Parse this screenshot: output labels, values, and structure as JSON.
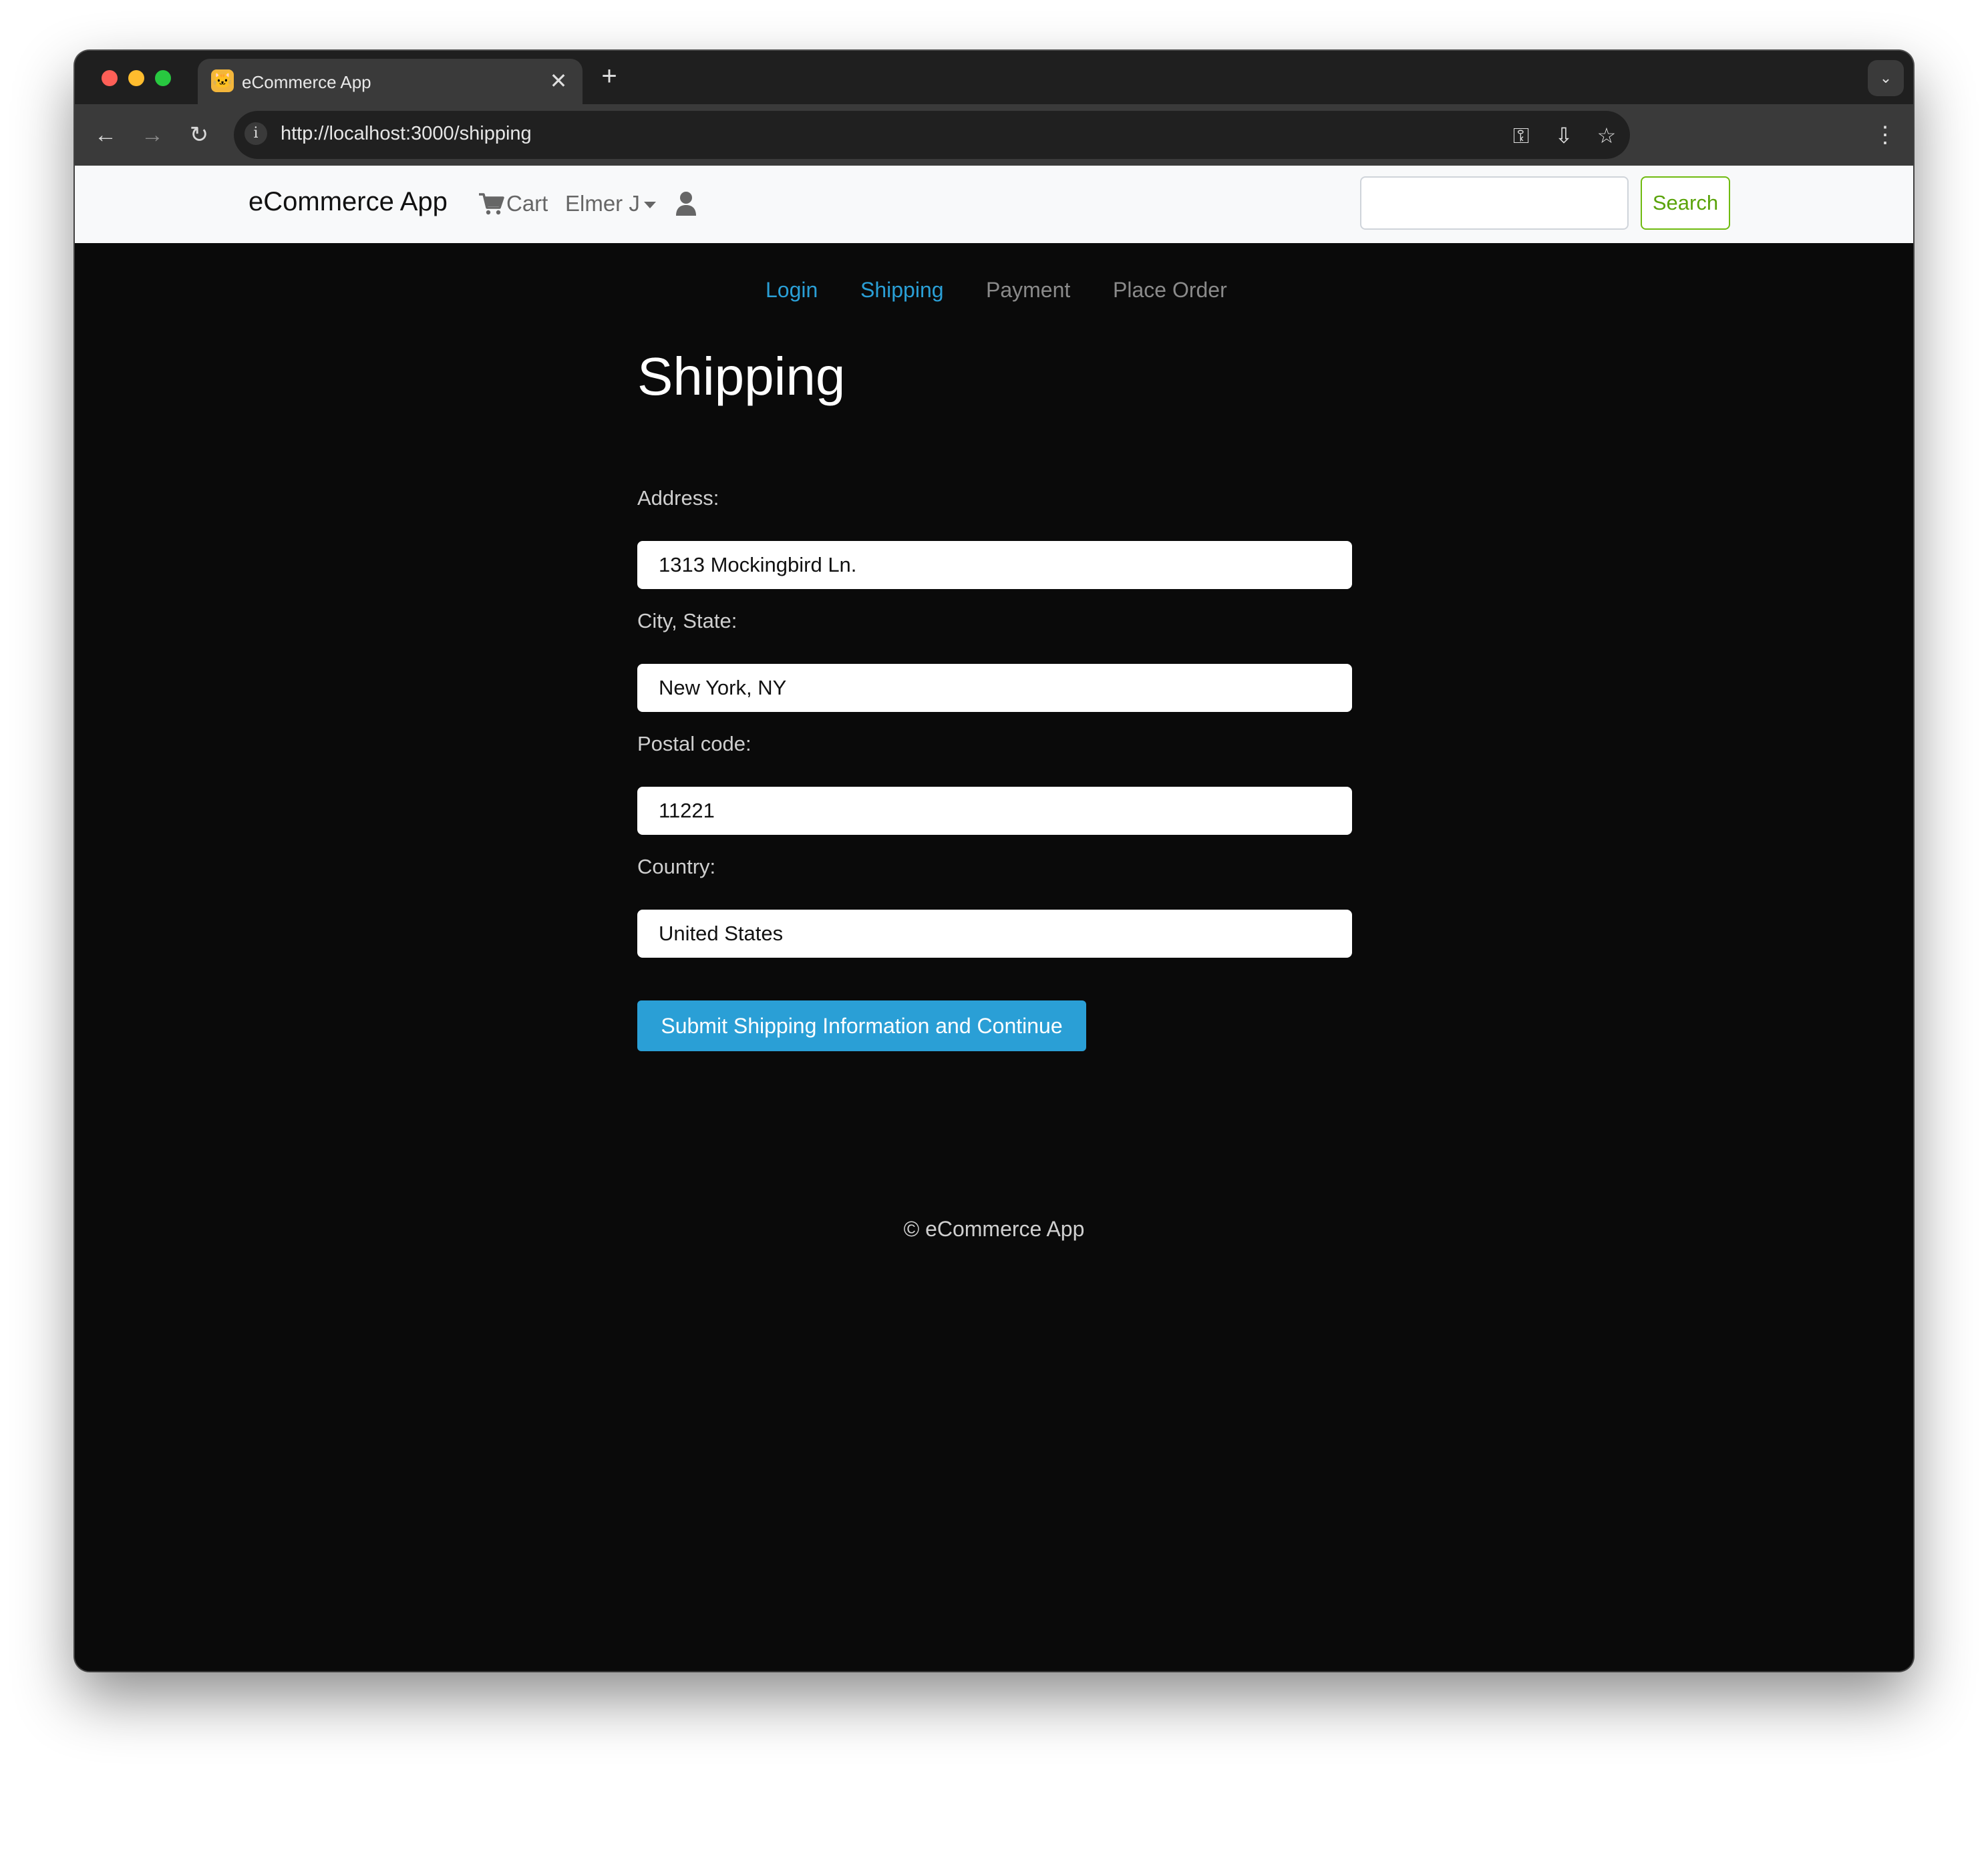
{
  "browser": {
    "tab_title": "eCommerce App",
    "tab_favicon": "🐱",
    "tab_close": "✕",
    "new_tab": "+",
    "tab_menu": "⌄",
    "back_icon": "←",
    "forward_icon": "→",
    "reload_icon": "↻",
    "url": "http://localhost:3000/shipping",
    "info_icon": "i",
    "key_icon": "⚿",
    "install_icon": "⇩",
    "star_icon": "☆",
    "menu_icon": "⋮"
  },
  "navbar": {
    "brand": "eCommerce App",
    "cart_label": "Cart",
    "user_name": "Elmer J",
    "search_placeholder": "",
    "search_button": "Search"
  },
  "steps": [
    {
      "label": "Login",
      "state": "active"
    },
    {
      "label": "Shipping",
      "state": "active"
    },
    {
      "label": "Payment",
      "state": "disabled"
    },
    {
      "label": "Place Order",
      "state": "disabled"
    }
  ],
  "form": {
    "title": "Shipping",
    "fields": [
      {
        "label": "Address:",
        "value": "1313 Mockingbird Ln."
      },
      {
        "label": "City, State:",
        "value": "New York, NY"
      },
      {
        "label": "Postal code:",
        "value": "11221"
      },
      {
        "label": "Country:",
        "value": "United States"
      }
    ],
    "submit_label": "Submit Shipping Information and Continue"
  },
  "footer": {
    "text": "© eCommerce App"
  },
  "colors": {
    "accent": "#2a9fd6",
    "search_green": "#5aa30a",
    "page_bg": "#0a0a0a",
    "navbar_bg": "#f8f9fa"
  }
}
